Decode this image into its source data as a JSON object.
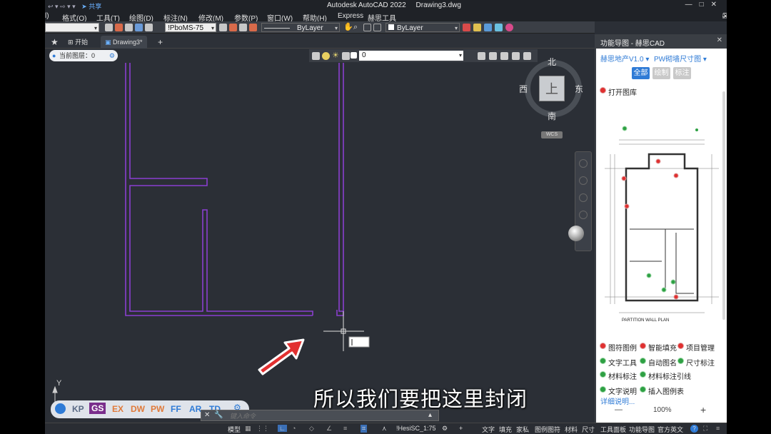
{
  "window": {
    "title": "Autodesk AutoCAD 2022",
    "document": "Drawing3.dwg",
    "share_label": "共享",
    "qat_left": "↩ ▾ ⇨ ▾ ▾"
  },
  "menu": {
    "items": [
      "l)",
      "格式(O)",
      "工具(T)",
      "绘图(D)",
      "标注(N)",
      "修改(M)",
      "参数(P)",
      "窗口(W)",
      "帮助(H)",
      "Express",
      "赫思工具"
    ]
  },
  "toolbar": {
    "dimstyle": "!PboMS-75",
    "linetype": "ByLayer",
    "color": "ByLayer"
  },
  "tabs": {
    "start": "开始",
    "drawing": "Drawing3*",
    "add": "+"
  },
  "layer_status": {
    "label": "当前图层：0"
  },
  "layer_bar": {
    "current": "0"
  },
  "viewcube": {
    "north": "北",
    "south": "南",
    "east": "东",
    "west": "西",
    "face": "上",
    "wcs": "WCS"
  },
  "axis": {
    "y_label": "Y"
  },
  "subtitle": "所以我们要把这里封闭",
  "launcher": {
    "apps": [
      {
        "label": "KP",
        "color": "#5a6a85"
      },
      {
        "label": "GS",
        "color": "#ffffff",
        "bg": "#7a2e8c"
      },
      {
        "label": "EX",
        "color": "#e07a3a"
      },
      {
        "label": "DW",
        "color": "#e07a3a"
      },
      {
        "label": "PW",
        "color": "#e07a3a"
      },
      {
        "label": "FF",
        "color": "#2f7bd6"
      },
      {
        "label": "AR",
        "color": "#2f7bd6"
      },
      {
        "label": "TD",
        "color": "#2f7bd6"
      }
    ]
  },
  "command": {
    "placeholder": "键入命令"
  },
  "status": {
    "model": "模型",
    "scale": "!HesiSC_1:75",
    "items": [
      "文字",
      "填充",
      "家私",
      "图例图符",
      "材料",
      "尺寸",
      "工具面板",
      "功能导图",
      "官方英文"
    ]
  },
  "side_panel": {
    "title": "功能导图 - 赫思CAD",
    "dropdown1": "赫思地产V1.0",
    "dropdown2": "PW砌墙尺寸图",
    "filters": [
      "全部",
      "绘制",
      "标注"
    ],
    "open_library": "打开图库",
    "plan_title": "PARTITION WALL PLAN",
    "features": [
      {
        "label": "图符图例",
        "status": "red"
      },
      {
        "label": "智能填充",
        "status": "red"
      },
      {
        "label": "项目管理",
        "status": "red"
      },
      {
        "label": "文字工具",
        "status": "green"
      },
      {
        "label": "自动图名",
        "status": "green"
      },
      {
        "label": "尺寸标注",
        "status": "green"
      },
      {
        "label": "材料标注",
        "status": "green"
      },
      {
        "label": "材料标注引线",
        "status": "green"
      },
      {
        "label": "文字说明",
        "status": "green"
      },
      {
        "label": "插入图例表",
        "status": "green"
      }
    ],
    "detail_link": "详细说明...",
    "zoom": "100%",
    "zoom_minus": "—",
    "zoom_plus": "+"
  },
  "colors": {
    "wall": "#8a3fd0",
    "background": "#2b2f36",
    "accent_blue": "#2f7bd6"
  }
}
